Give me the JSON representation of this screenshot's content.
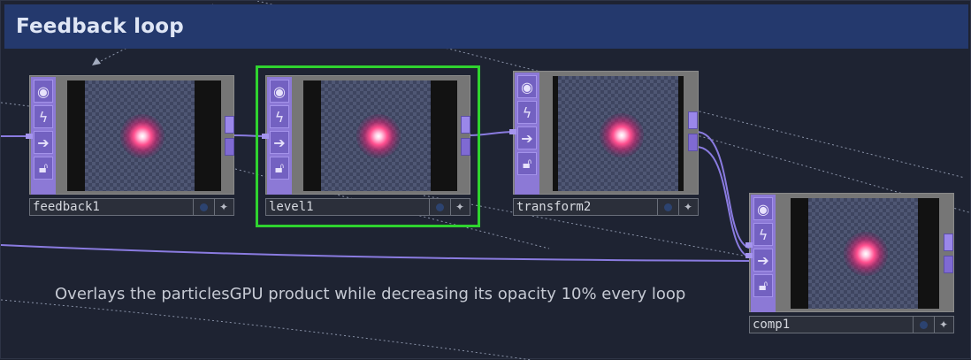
{
  "header": {
    "title": "Feedback loop"
  },
  "comment": {
    "text": "Overlays the particlesGPU product while decreasing its opacity 10% every loop"
  },
  "nodes": [
    {
      "name": "feedback1",
      "selected": false
    },
    {
      "name": "level1",
      "selected": true
    },
    {
      "name": "transform2",
      "selected": false
    },
    {
      "name": "comp1",
      "selected": false
    }
  ],
  "colors": {
    "selection": "#2fd32f",
    "strip": "#8c79d6",
    "wire": "#8a7be0",
    "header": "#24396d"
  },
  "icons": {
    "strip_buttons": [
      "viewer-toggle-icon",
      "bypass-icon",
      "display-arrow-icon",
      "lock-icon"
    ],
    "namebar_buttons": [
      "viewer-active-icon",
      "pin-icon"
    ]
  }
}
